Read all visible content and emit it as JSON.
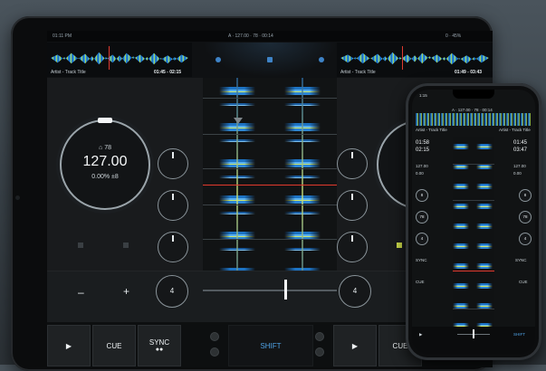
{
  "ipad": {
    "status_time": "01:11 PM",
    "status_center": "A · 127.00 · 78 · 00:14",
    "status_battery": "0 · 45%",
    "deck_a": {
      "track": "Artist - Track Title",
      "time": "01:45 - 02:15",
      "key": "78",
      "bpm": "127.00",
      "pitch": "0.00%  ±8"
    },
    "deck_b": {
      "track": "Artist - Track Title",
      "time": "01:49 - 03:43"
    },
    "minus_label": "–",
    "plus_label": "+",
    "beatjump_left": "4",
    "beatjump_right": "4",
    "buttons": {
      "play_left": "▶",
      "cue_left": "CUE",
      "sync_left": "SYNC",
      "shift": "SHIFT",
      "play_right": "▶",
      "cue_right": "CUE"
    }
  },
  "iphone": {
    "time": "1:15",
    "header_center": "A · 127.00 · 78 · 00:14",
    "left_info": "Artist - Track Title",
    "right_info": "Artist - Track Title",
    "left_time": "01:58",
    "left_remain": "02:15",
    "left_bpm": "127.00",
    "left_pitch": "0.00",
    "right_time": "01:45",
    "right_remain": "03:47",
    "right_bpm": "127.00",
    "right_pitch": "0.00",
    "knob_labels": [
      "8",
      "78",
      "4"
    ],
    "cue": "CUE",
    "sync": "SYNC",
    "shift": "SHIFT"
  },
  "colors": {
    "accent": "#4fa3e6",
    "playhead": "#e03a2f",
    "wave_blue": "#2a86d2",
    "wave_green": "#cde66c"
  }
}
